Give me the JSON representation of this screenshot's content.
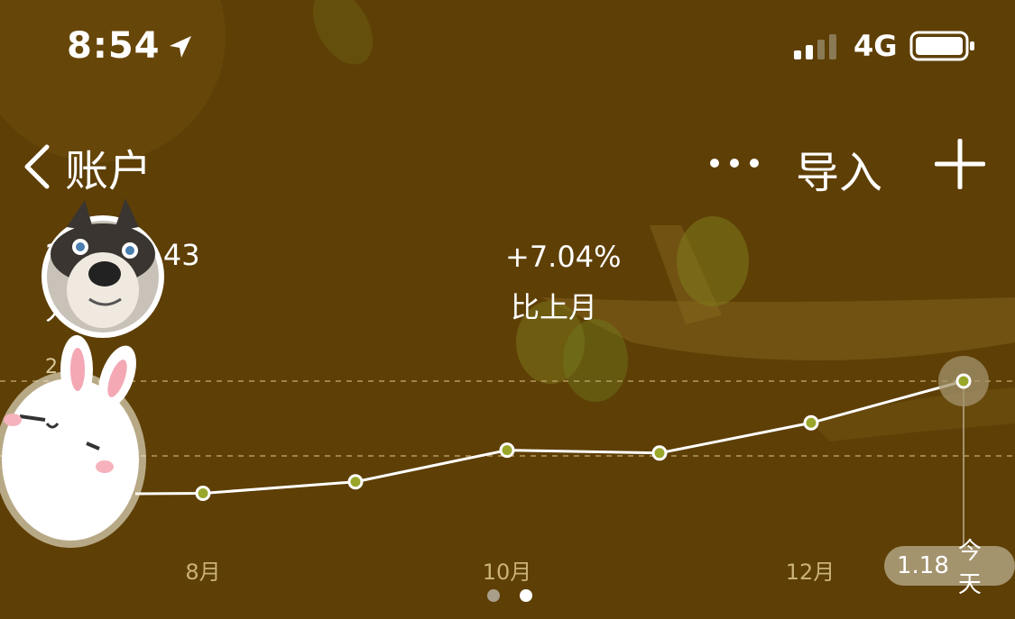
{
  "status_bar": {
    "time": "8:54",
    "network": "4G",
    "location_icon": "location-arrow-icon",
    "signal_icon": "signal-bars-icon",
    "battery_icon": "battery-icon"
  },
  "nav": {
    "back_label": "账户",
    "back_icon": "chevron-left-icon",
    "more_icon": "ellipsis-icon",
    "import_label": "导入",
    "add_icon": "plus-icon"
  },
  "summary": {
    "balance_visible": "3.43",
    "balance_prefix_visible": "2",
    "sub_left_visible": "人",
    "y_label_visible": "2",
    "change": "+7.04%",
    "change_label": "比上月"
  },
  "chart_data": {
    "type": "line",
    "x_ticks": [
      "8月",
      "10月",
      "12月"
    ],
    "highlight_label": {
      "date": "1.18",
      "label": "今天"
    },
    "series": [
      {
        "values": [
          null,
          0.52,
          0.6,
          0.82,
          0.8,
          1.01,
          1.3
        ]
      }
    ],
    "grid": true
  },
  "pager": {
    "pages": 2,
    "active": 2
  },
  "colors": {
    "background": "#5e3f06",
    "point_fill": "#9aa62a",
    "line": "#ffffff",
    "badge": "#a4946e"
  }
}
